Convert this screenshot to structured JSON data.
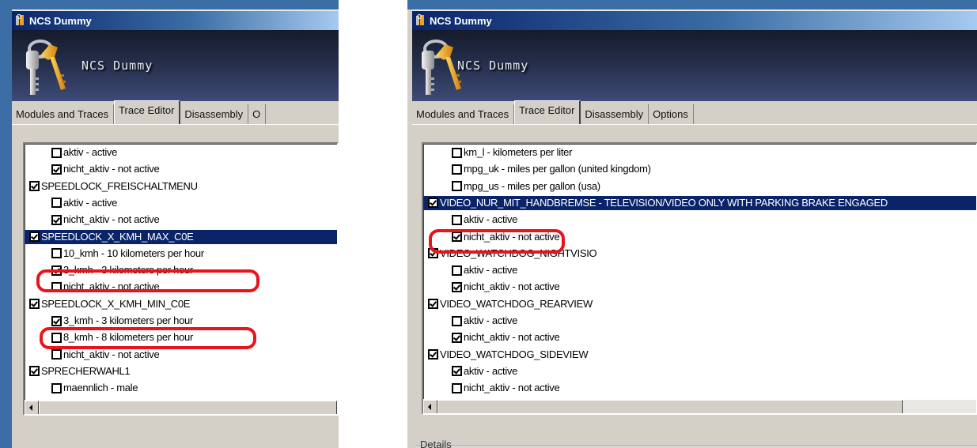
{
  "colors": {
    "selection": "#0a246a",
    "highlight_circle": "#e8141c",
    "window_bg": "#d4d0c8",
    "banner_dark": "#161b2b"
  },
  "left_window": {
    "title": "NCS Dummy",
    "title_icon": "keys-icon",
    "banner_title": "NCS Dummy",
    "tabs": [
      {
        "label": "Modules and Traces",
        "active": false
      },
      {
        "label": "Trace Editor",
        "active": true
      },
      {
        "label": "Disassembly",
        "active": false
      },
      {
        "label": "O",
        "active": false
      }
    ],
    "tree": [
      {
        "level": 1,
        "checked": false,
        "text": "aktiv  -  active"
      },
      {
        "level": 1,
        "checked": true,
        "text": "nicht_aktiv  -  not active"
      },
      {
        "level": 0,
        "checked": true,
        "text": "SPEEDLOCK_FREISCHALTMENU"
      },
      {
        "level": 1,
        "checked": false,
        "text": "aktiv  -  active"
      },
      {
        "level": 1,
        "checked": true,
        "text": "nicht_aktiv  -  not active"
      },
      {
        "level": 0,
        "checked": true,
        "text": "SPEEDLOCK_X_KMH_MAX_C0E",
        "selected": true
      },
      {
        "level": 1,
        "checked": false,
        "text": "10_kmh  -  10 kilometers per hour"
      },
      {
        "level": 1,
        "checked": true,
        "text": "3_kmh  -  3 kilometers per hour",
        "highlighted": true
      },
      {
        "level": 1,
        "checked": false,
        "text": "nicht_aktiv  -  not active"
      },
      {
        "level": 0,
        "checked": true,
        "text": "SPEEDLOCK_X_KMH_MIN_C0E"
      },
      {
        "level": 1,
        "checked": true,
        "text": "3_kmh  -  3 kilometers per hour",
        "highlighted": true
      },
      {
        "level": 1,
        "checked": false,
        "text": "8_kmh  -  8 kilometers per hour"
      },
      {
        "level": 1,
        "checked": false,
        "text": "nicht_aktiv  -  not active"
      },
      {
        "level": 0,
        "checked": true,
        "text": "SPRECHERWAHL1"
      },
      {
        "level": 1,
        "checked": false,
        "text": "maennlich  -  male"
      }
    ]
  },
  "right_window": {
    "title": "NCS Dummy",
    "title_icon": "keys-icon",
    "banner_title": "NCS Dummy",
    "tabs": [
      {
        "label": "Modules and Traces",
        "active": false
      },
      {
        "label": "Trace Editor",
        "active": true
      },
      {
        "label": "Disassembly",
        "active": false
      },
      {
        "label": "Options",
        "active": false
      }
    ],
    "tree": [
      {
        "level": 1,
        "checked": false,
        "text": "km_l  -  kilometers per liter"
      },
      {
        "level": 1,
        "checked": false,
        "text": "mpg_uk  -  miles per gallon (united kingdom)"
      },
      {
        "level": 1,
        "checked": false,
        "text": "mpg_us  -  miles per gallon (usa)"
      },
      {
        "level": 0,
        "checked": true,
        "text": "VIDEO_NUR_MIT_HANDBREMSE  -  TELEVISION/VIDEO ONLY WITH PARKING BRAKE ENGAGED",
        "selected": true
      },
      {
        "level": 1,
        "checked": false,
        "text": "aktiv  -  active"
      },
      {
        "level": 1,
        "checked": true,
        "text": "nicht_aktiv  -  not active",
        "highlighted": true
      },
      {
        "level": 0,
        "checked": true,
        "text": "VIDEO_WATCHDOG_NIGHTVISIO"
      },
      {
        "level": 1,
        "checked": false,
        "text": "aktiv  -  active"
      },
      {
        "level": 1,
        "checked": true,
        "text": "nicht_aktiv  -  not active"
      },
      {
        "level": 0,
        "checked": true,
        "text": "VIDEO_WATCHDOG_REARVIEW"
      },
      {
        "level": 1,
        "checked": false,
        "text": "aktiv  -  active"
      },
      {
        "level": 1,
        "checked": true,
        "text": "nicht_aktiv  -  not active"
      },
      {
        "level": 0,
        "checked": true,
        "text": "VIDEO_WATCHDOG_SIDEVIEW"
      },
      {
        "level": 1,
        "checked": true,
        "text": "aktiv  -  active"
      },
      {
        "level": 1,
        "checked": false,
        "text": "nicht_aktiv  -  not active"
      }
    ],
    "details_label": "Details"
  }
}
